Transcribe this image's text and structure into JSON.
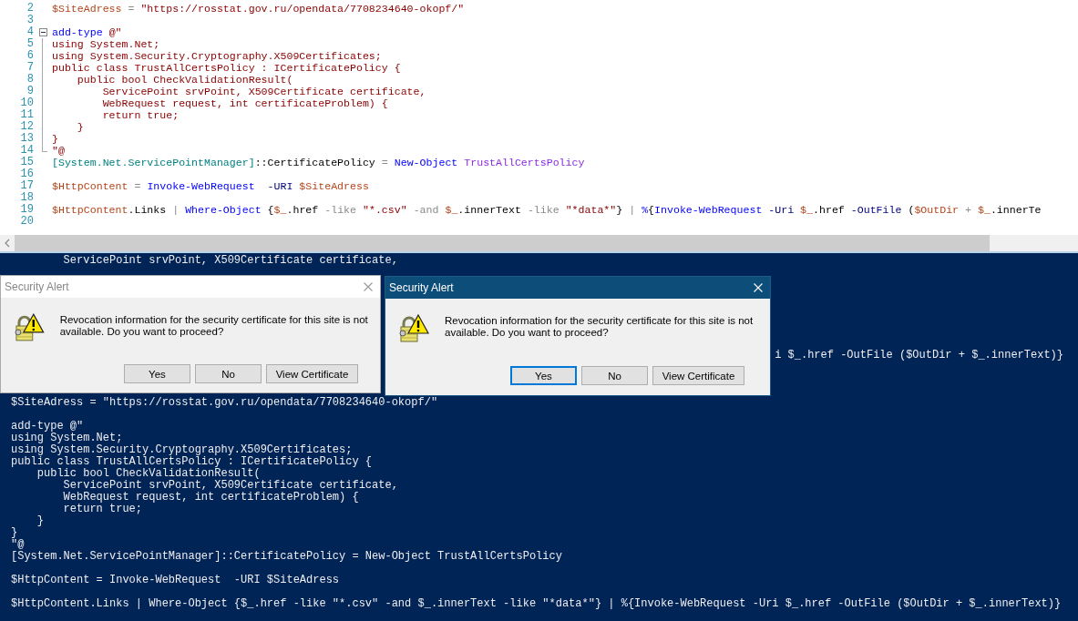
{
  "editor": {
    "lines": [
      {
        "number": "2",
        "kind": "plain",
        "tokens": [
          {
            "text": "$SiteAdress",
            "kind": "variable"
          },
          {
            "text": " = ",
            "kind": "operator"
          },
          {
            "text": "\"https://rosstat.gov.ru/opendata/7708234640-okopf/\"",
            "kind": "string"
          }
        ]
      },
      {
        "number": "3",
        "kind": "plain"
      },
      {
        "number": "4",
        "kind": "fold_start",
        "tokens": [
          {
            "text": "add-type",
            "kind": "command"
          },
          {
            "text": " @\"",
            "kind": "string"
          }
        ]
      },
      {
        "number": "5",
        "kind": "fold_body",
        "tokens": [
          {
            "text": "using System.Net;",
            "kind": "string"
          }
        ]
      },
      {
        "number": "6",
        "kind": "fold_body",
        "tokens": [
          {
            "text": "using System.Security.Cryptography.X509Certificates;",
            "kind": "string"
          }
        ]
      },
      {
        "number": "7",
        "kind": "fold_body",
        "tokens": [
          {
            "text": "public class TrustAllCertsPolicy : ICertificatePolicy {",
            "kind": "string"
          }
        ]
      },
      {
        "number": "8",
        "kind": "fold_body",
        "tokens": [
          {
            "text": "    public bool CheckValidationResult(",
            "kind": "string"
          }
        ]
      },
      {
        "number": "9",
        "kind": "fold_body",
        "tokens": [
          {
            "text": "        ServicePoint srvPoint, X509Certificate certificate,",
            "kind": "string"
          }
        ]
      },
      {
        "number": "10",
        "kind": "fold_body",
        "tokens": [
          {
            "text": "        WebRequest request, int certificateProblem) {",
            "kind": "string"
          }
        ]
      },
      {
        "number": "11",
        "kind": "fold_body",
        "tokens": [
          {
            "text": "        return true;",
            "kind": "string"
          }
        ]
      },
      {
        "number": "12",
        "kind": "fold_body",
        "tokens": [
          {
            "text": "    }",
            "kind": "string"
          }
        ]
      },
      {
        "number": "13",
        "kind": "fold_body",
        "tokens": [
          {
            "text": "}",
            "kind": "string"
          }
        ]
      },
      {
        "number": "14",
        "kind": "fold_end",
        "tokens": [
          {
            "text": "\"@",
            "kind": "string"
          }
        ]
      },
      {
        "number": "15",
        "kind": "plain",
        "tokens": [
          {
            "text": "[System.Net.ServicePointManager]",
            "kind": "type"
          },
          {
            "text": "::CertificatePolicy",
            "kind": "member"
          },
          {
            "text": " = ",
            "kind": "operator"
          },
          {
            "text": "New-Object",
            "kind": "command"
          },
          {
            "text": " TrustAllCertsPolicy",
            "kind": "argument"
          }
        ]
      },
      {
        "number": "16",
        "kind": "plain"
      },
      {
        "number": "17",
        "kind": "plain",
        "tokens": [
          {
            "text": "$HttpContent",
            "kind": "variable"
          },
          {
            "text": " = ",
            "kind": "operator"
          },
          {
            "text": "Invoke-WebRequest",
            "kind": "command"
          },
          {
            "text": "  -URI",
            "kind": "parameter"
          },
          {
            "text": " $SiteAdress",
            "kind": "variable"
          }
        ]
      },
      {
        "number": "18",
        "kind": "plain"
      },
      {
        "number": "19",
        "kind": "plain",
        "tokens": [
          {
            "text": "$HttpContent",
            "kind": "variable"
          },
          {
            "text": ".Links",
            "kind": "member"
          },
          {
            "text": " | ",
            "kind": "operator"
          },
          {
            "text": "Where-Object",
            "kind": "command"
          },
          {
            "text": " {",
            "kind": "member"
          },
          {
            "text": "$_",
            "kind": "variable"
          },
          {
            "text": ".href",
            "kind": "member"
          },
          {
            "text": " -like ",
            "kind": "operator"
          },
          {
            "text": "\"*.csv\"",
            "kind": "string"
          },
          {
            "text": " -and ",
            "kind": "operator"
          },
          {
            "text": "$_",
            "kind": "variable"
          },
          {
            "text": ".innerText",
            "kind": "member"
          },
          {
            "text": " -like ",
            "kind": "operator"
          },
          {
            "text": "\"*data*\"",
            "kind": "string"
          },
          {
            "text": "}",
            "kind": "member"
          },
          {
            "text": " | ",
            "kind": "operator"
          },
          {
            "text": "%",
            "kind": "command"
          },
          {
            "text": "{",
            "kind": "member"
          },
          {
            "text": "Invoke-WebRequest",
            "kind": "command"
          },
          {
            "text": " -Uri ",
            "kind": "parameter"
          },
          {
            "text": "$_",
            "kind": "variable"
          },
          {
            "text": ".href ",
            "kind": "member"
          },
          {
            "text": "-OutFile",
            "kind": "parameter"
          },
          {
            "text": " (",
            "kind": "member"
          },
          {
            "text": "$OutDir",
            "kind": "variable"
          },
          {
            "text": " + ",
            "kind": "operator"
          },
          {
            "text": "$_",
            "kind": "variable"
          },
          {
            "text": ".innerTe",
            "kind": "member"
          }
        ]
      },
      {
        "number": "20",
        "kind": "plain"
      }
    ]
  },
  "console": {
    "lines": [
      {
        "kind": "line",
        "text": "        ServicePoint srvPoint, X509Certificate certificate,"
      },
      {
        "kind": "blank"
      },
      {
        "kind": "blank"
      },
      {
        "kind": "blank"
      },
      {
        "kind": "blank"
      },
      {
        "kind": "blank"
      },
      {
        "kind": "blank"
      },
      {
        "kind": "blank"
      },
      {
        "kind": "tail",
        "text": "i $_.href -OutFile ($OutDir + $_.innerText)}"
      },
      {
        "kind": "blank"
      },
      {
        "kind": "blank"
      },
      {
        "kind": "blank"
      },
      {
        "kind": "line",
        "text": "$SiteAdress = \"https://rosstat.gov.ru/opendata/7708234640-okopf/\""
      },
      {
        "kind": "blank"
      },
      {
        "kind": "line",
        "text": "add-type @\""
      },
      {
        "kind": "line",
        "text": "using System.Net;"
      },
      {
        "kind": "line",
        "text": "using System.Security.Cryptography.X509Certificates;"
      },
      {
        "kind": "line",
        "text": "public class TrustAllCertsPolicy : ICertificatePolicy {"
      },
      {
        "kind": "line",
        "text": "    public bool CheckValidationResult("
      },
      {
        "kind": "line",
        "text": "        ServicePoint srvPoint, X509Certificate certificate,"
      },
      {
        "kind": "line",
        "text": "        WebRequest request, int certificateProblem) {"
      },
      {
        "kind": "line",
        "text": "        return true;"
      },
      {
        "kind": "line",
        "text": "    }"
      },
      {
        "kind": "line",
        "text": "}"
      },
      {
        "kind": "line",
        "text": "\"@"
      },
      {
        "kind": "line",
        "text": "[System.Net.ServicePointManager]::CertificatePolicy = New-Object TrustAllCertsPolicy"
      },
      {
        "kind": "blank"
      },
      {
        "kind": "line",
        "text": "$HttpContent = Invoke-WebRequest  -URI $SiteAdress"
      },
      {
        "kind": "blank"
      },
      {
        "kind": "line",
        "text": "$HttpContent.Links | Where-Object {$_.href -like \"*.csv\" -and $_.innerText -like \"*data*\"} | %{Invoke-WebRequest -Uri $_.href -OutFile ($OutDir + $_.innerText)}"
      }
    ]
  },
  "dialogs": [
    {
      "title": "Security Alert",
      "active": false,
      "message": "Revocation information for the security certificate for this site is not available. Do you want to proceed?",
      "buttons": [
        {
          "label": "Yes",
          "focused": false
        },
        {
          "label": "No",
          "focused": false
        },
        {
          "label": "View Certificate",
          "focused": false
        }
      ]
    },
    {
      "title": "Security Alert",
      "active": true,
      "message": "Revocation information for the security certificate for this site is not available. Do you want to proceed?",
      "buttons": [
        {
          "label": "Yes",
          "focused": true
        },
        {
          "label": "No",
          "focused": false
        },
        {
          "label": "View Certificate",
          "focused": false
        }
      ]
    }
  ]
}
